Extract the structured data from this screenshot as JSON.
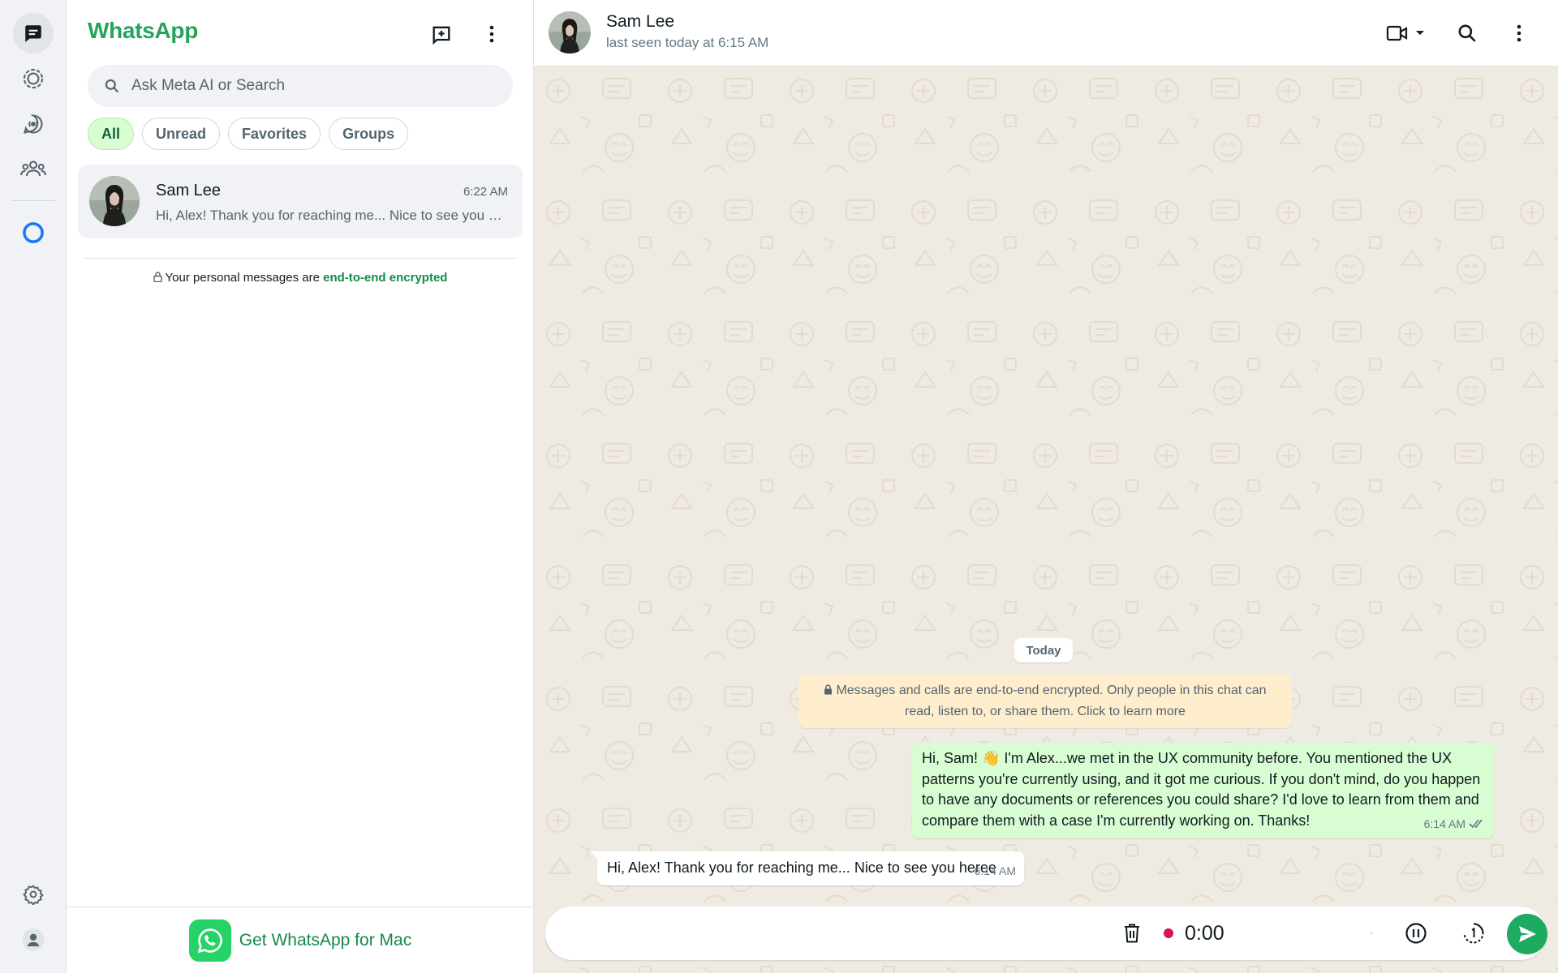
{
  "app": {
    "title": "WhatsApp"
  },
  "rail": {
    "items": [
      {
        "name": "chats-icon",
        "active": true
      },
      {
        "name": "status-icon"
      },
      {
        "name": "channels-icon"
      },
      {
        "name": "communities-icon"
      },
      {
        "name": "meta-ai-icon"
      },
      {
        "name": "settings-icon"
      },
      {
        "name": "profile-icon"
      }
    ]
  },
  "header_icons": [
    "new-chat-icon",
    "menu-dots-icon"
  ],
  "search": {
    "placeholder": "Ask Meta AI or Search"
  },
  "filters": [
    "All",
    "Unread",
    "Favorites",
    "Groups"
  ],
  "chats": [
    {
      "name": "Sam Lee",
      "time": "6:22 AM",
      "preview": "Hi, Alex! Thank you for reaching me... Nice to see you heree"
    }
  ],
  "encryption_note": {
    "prefix": "Your personal messages are",
    "link": "end-to-end encrypted"
  },
  "get_app": {
    "label": "Get WhatsApp for Mac"
  },
  "conversation": {
    "contact": "Sam Lee",
    "status": "last seen today at 6:15 AM",
    "date_divider": "Today",
    "system_message": "Messages and calls are end-to-end encrypted. Only people in this chat can read, listen to, or share them. Click to learn more",
    "messages": [
      {
        "direction": "outgoing",
        "text": "Hi, Sam! 👋 I'm Alex...we met in the UX community before. You mentioned the UX patterns you're currently using, and it got me curious. If you don't mind, do you happen to have any documents or references you could share? I'd love to learn from them and compare them with a case I'm currently working on. Thanks!",
        "time": "6:14 AM",
        "status": "read"
      },
      {
        "direction": "incoming",
        "text": "Hi, Alex! Thank you for reaching me... Nice to see you heree",
        "time": "6:14 AM"
      }
    ]
  },
  "composer": {
    "recording_time": "0:00"
  },
  "colors": {
    "brand": "#25a35a",
    "outgoing_bubble": "#d9fdd3",
    "chat_bg": "#efeae2",
    "send": "#1daa61",
    "record_dot": "#d4174f"
  }
}
